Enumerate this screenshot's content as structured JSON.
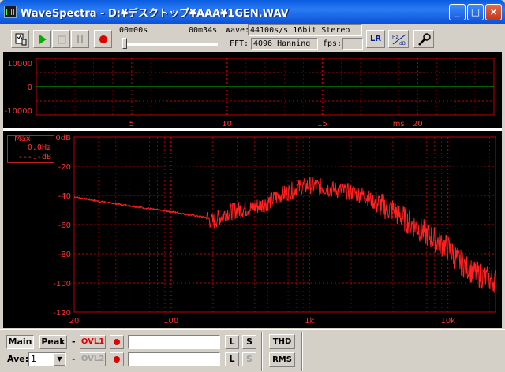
{
  "window": {
    "title": "WaveSpectra - D:¥デスクトップ¥AAA¥1GEN.WAV",
    "buttons": [
      "minimize",
      "maximize",
      "close"
    ]
  },
  "toolbar": {
    "time_start": "00m00s",
    "time_end": "00m34s",
    "playback_position": 0.0,
    "wave_label": "Wave:",
    "wave_value": "44100s/s 16bit Stereo",
    "fft_label": "FFT:",
    "fft_value": "4096 Hanning",
    "fps_label": "fps:",
    "fps_value": "",
    "lr_label": "LR",
    "hzdb_label": "Hz dB"
  },
  "waveform": {
    "y_ticks": [
      "10000",
      "0",
      "-10000"
    ],
    "x_ticks": [
      "5",
      "10",
      "15",
      "20"
    ],
    "x_unit": "ms",
    "trace_color": "#00c000",
    "grid_color": "#c00000"
  },
  "spectrum": {
    "max_box": {
      "label": "Max",
      "freq": "0.0Hz",
      "level": "---.-dB"
    },
    "y_ticks": [
      "0dB",
      "-20",
      "-40",
      "-60",
      "-80",
      "-100",
      "-120"
    ],
    "x_ticks": [
      "20",
      "100",
      "1k",
      "10k"
    ],
    "trace_color": "#ff2020",
    "grid_color": "#c00000"
  },
  "chart_data": [
    {
      "type": "line",
      "title": "",
      "xlabel": "ms",
      "ylabel": "",
      "x_ticks": [
        5,
        10,
        15,
        20
      ],
      "y_ticks": [
        10000,
        0,
        -10000
      ],
      "series": [
        {
          "x": [
            0,
            24
          ],
          "values": [
            0,
            0
          ]
        }
      ],
      "grid": true
    },
    {
      "type": "line",
      "title": "",
      "xlabel": "",
      "ylabel": "",
      "x_scale": "log",
      "xlim": [
        20,
        22050
      ],
      "ylim": [
        -120,
        0
      ],
      "x_ticks": [
        "20",
        "100",
        "1k",
        "10k"
      ],
      "y_ticks": [
        "0dB",
        "-20",
        "-40",
        "-60",
        "-80",
        "-100",
        "-120"
      ],
      "series": [
        {
          "x": [
            20,
            30,
            50,
            80,
            100,
            130,
            150,
            180,
            200,
            250,
            300,
            400,
            500,
            600,
            700,
            800,
            1000,
            1200,
            1500,
            2000,
            2500,
            3000,
            4000,
            5000,
            6000,
            8000,
            10000,
            12000,
            15000,
            20000
          ],
          "values": [
            -41,
            -44,
            -47,
            -50,
            -51,
            -53,
            -54,
            -55,
            -58,
            -52,
            -50,
            -48,
            -45,
            -40,
            -38,
            -35,
            -33,
            -34,
            -36,
            -38,
            -40,
            -45,
            -50,
            -57,
            -62,
            -70,
            -76,
            -85,
            -92,
            -98
          ]
        }
      ],
      "grid": true
    }
  ],
  "bottom": {
    "tab_main": "Main",
    "tab_peak": "Peak",
    "dash1": "-",
    "dash2": "-",
    "ovl1": "OVL1",
    "ovl2": "OVL2",
    "ave_label": "Ave:",
    "ave_value": "1",
    "l1": "L",
    "s1": "S",
    "l2": "L",
    "s2": "S",
    "thd": "THD",
    "rms": "RMS"
  }
}
